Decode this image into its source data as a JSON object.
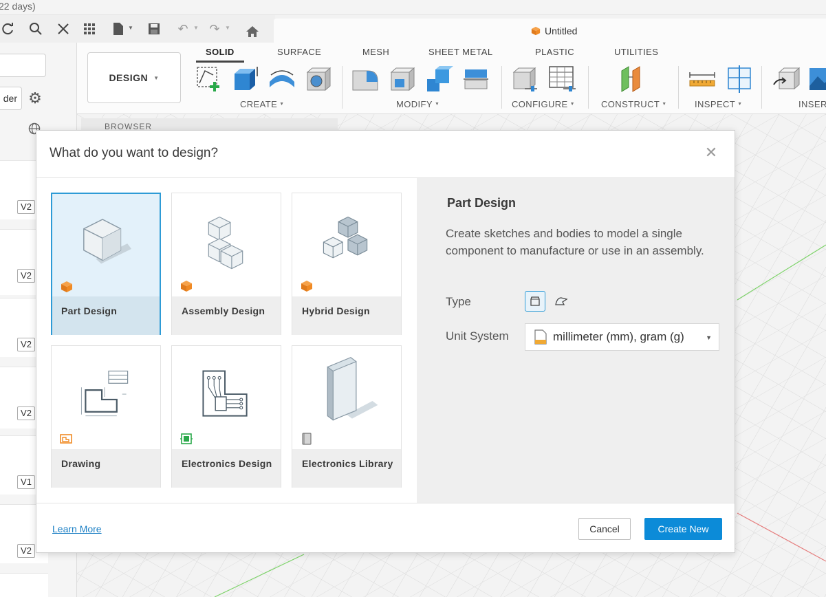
{
  "top": {
    "trial_text": "22 days)"
  },
  "document": {
    "title": "Untitled"
  },
  "ribbon": {
    "workspace": "DESIGN",
    "tabs": [
      "SOLID",
      "SURFACE",
      "MESH",
      "SHEET METAL",
      "PLASTIC",
      "UTILITIES"
    ],
    "groups": [
      "CREATE",
      "MODIFY",
      "CONFIGURE",
      "CONSTRUCT",
      "INSPECT",
      "INSERT"
    ]
  },
  "left": {
    "folder_label": "der",
    "versions": [
      "V2",
      "V2",
      "V2",
      "V2",
      "V1",
      "V2"
    ]
  },
  "browser": {
    "label": "BROWSER"
  },
  "dialog": {
    "title": "What do you want to design?",
    "cards": [
      {
        "label": "Part Design"
      },
      {
        "label": "Assembly Design"
      },
      {
        "label": "Hybrid Design"
      },
      {
        "label": "Drawing"
      },
      {
        "label": "Electronics Design"
      },
      {
        "label": "Electronics Library"
      }
    ],
    "info": {
      "title": "Part Design",
      "description": "Create sketches and bodies to model a single component to manufacture or use in an assembly.",
      "type_label": "Type",
      "unit_label": "Unit System",
      "unit_value": "millimeter (mm), gram (g)"
    },
    "learn_more": "Learn More",
    "cancel": "Cancel",
    "create_new": "Create New"
  },
  "colors": {
    "accent": "#0c8bd8",
    "selected_border": "#2e9bd6",
    "autodesk_orange": "#f08a24"
  }
}
